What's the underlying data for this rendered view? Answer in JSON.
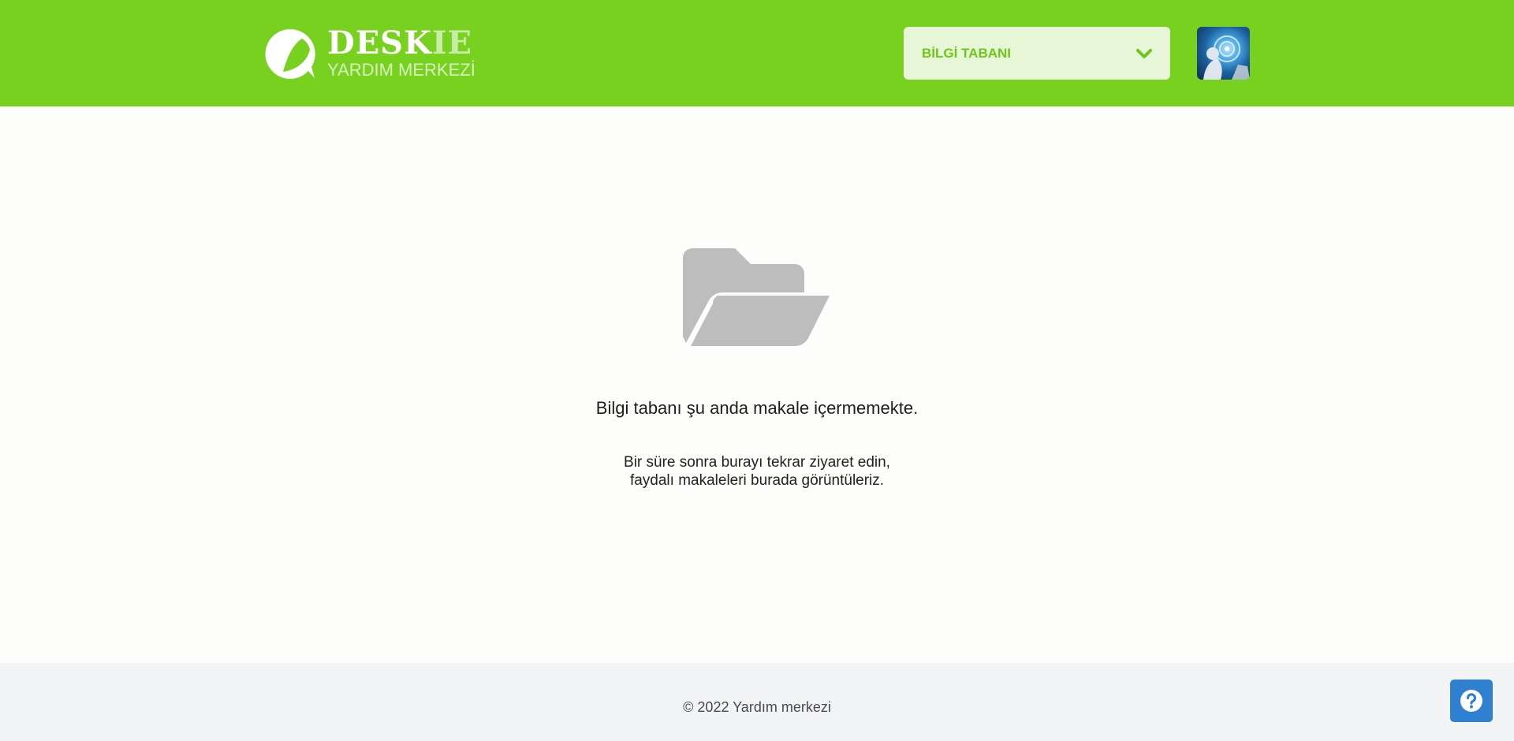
{
  "header": {
    "logo": {
      "brand_main": "DESK",
      "brand_accent": "IE",
      "subtitle": "YARDIM MERKEZİ",
      "icon": "chat-bubble-logo-icon"
    },
    "kb_select": {
      "selected": "BİLGİ TABANI",
      "icon": "chevron-down-icon"
    },
    "avatar": {
      "icon": "user-avatar"
    }
  },
  "empty_state": {
    "icon": "folder-open-icon",
    "title": "Bilgi tabanı şu anda makale içermemekte.",
    "description_line1": "Bir süre sonra burayı tekrar ziyaret edin,",
    "description_line2": "faydalı makaleleri burada görüntüleriz."
  },
  "footer": {
    "copyright": "© 2022 Yardım merkezi"
  },
  "help_button": {
    "icon": "question-circle-icon"
  },
  "colors": {
    "header_bg": "#78d11e",
    "select_bg": "#e6f6d6",
    "select_text": "#6fc61a",
    "folder_gray": "#bdbdbd",
    "footer_bg": "#f3f4f6",
    "help_blue": "#2f80d1"
  }
}
